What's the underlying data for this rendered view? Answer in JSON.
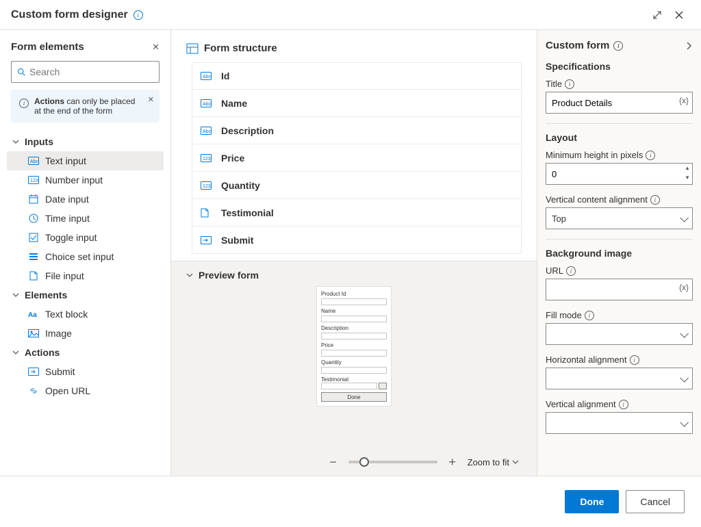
{
  "titlebar": {
    "title": "Custom form designer"
  },
  "left": {
    "header": "Form elements",
    "search_placeholder": "Search",
    "banner_bold": "Actions",
    "banner_text": " can only be placed at the end of the form",
    "groups": {
      "inputs": {
        "label": "Inputs",
        "items": [
          {
            "label": "Text input",
            "icon": "text-icon",
            "selected": true
          },
          {
            "label": "Number input",
            "icon": "number-icon"
          },
          {
            "label": "Date input",
            "icon": "date-icon"
          },
          {
            "label": "Time input",
            "icon": "time-icon"
          },
          {
            "label": "Toggle input",
            "icon": "toggle-icon"
          },
          {
            "label": "Choice set input",
            "icon": "choice-icon"
          },
          {
            "label": "File input",
            "icon": "file-icon"
          }
        ]
      },
      "elements": {
        "label": "Elements",
        "items": [
          {
            "label": "Text block",
            "icon": "textblock-icon"
          },
          {
            "label": "Image",
            "icon": "image-icon"
          }
        ]
      },
      "actions": {
        "label": "Actions",
        "items": [
          {
            "label": "Submit",
            "icon": "submit-icon"
          },
          {
            "label": "Open URL",
            "icon": "url-icon"
          }
        ]
      }
    }
  },
  "mid": {
    "structure_header": "Form structure",
    "rows": [
      {
        "label": "Id",
        "icon": "text-icon"
      },
      {
        "label": "Name",
        "icon": "text-icon"
      },
      {
        "label": "Description",
        "icon": "text-icon"
      },
      {
        "label": "Price",
        "icon": "number-icon"
      },
      {
        "label": "Quantity",
        "icon": "number-icon"
      },
      {
        "label": "Testimonial",
        "icon": "file-icon"
      },
      {
        "label": "Submit",
        "icon": "submit-icon"
      }
    ],
    "preview_header": "Preview form",
    "preview": {
      "fields": [
        "Product Id",
        "Name",
        "Description",
        "Price",
        "Quantity",
        "Testimonial"
      ],
      "done": "Done"
    },
    "zoom_fit": "Zoom to fit"
  },
  "right": {
    "header": "Custom form",
    "sec_specifications": "Specifications",
    "title_label": "Title",
    "title_value": "Product Details",
    "sec_layout": "Layout",
    "minheight_label": "Minimum height in pixels",
    "minheight_value": "0",
    "valign_label": "Vertical content alignment",
    "valign_value": "Top",
    "sec_bg": "Background image",
    "url_label": "URL",
    "url_value": "",
    "fill_label": "Fill mode",
    "fill_value": "",
    "halign_label": "Horizontal alignment",
    "halign_value": "",
    "valign2_label": "Vertical alignment",
    "valign2_value": ""
  },
  "footer": {
    "done": "Done",
    "cancel": "Cancel"
  }
}
